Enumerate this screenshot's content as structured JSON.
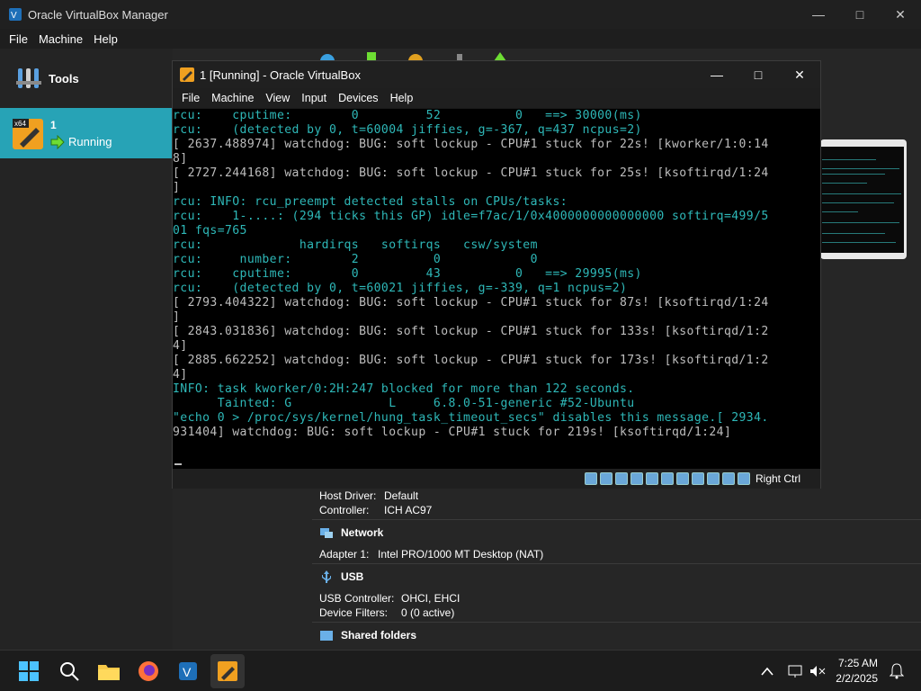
{
  "manager": {
    "title": "Oracle VirtualBox Manager",
    "menu": [
      "File",
      "Machine",
      "Help"
    ],
    "tools_label": "Tools",
    "vm": {
      "name": "1",
      "state": "Running",
      "badge": "x64"
    },
    "details": {
      "audio": {
        "host_driver_label": "Host Driver:",
        "host_driver": "Default",
        "controller_label": "Controller:",
        "controller": "ICH AC97"
      },
      "network": {
        "title": "Network",
        "adapter_label": "Adapter 1:",
        "adapter": "Intel PRO/1000 MT Desktop (NAT)"
      },
      "usb": {
        "title": "USB",
        "controller_label": "USB Controller:",
        "controller": "OHCI, EHCI",
        "filters_label": "Device Filters:",
        "filters": "0 (0 active)"
      },
      "shared": {
        "title": "Shared folders"
      }
    }
  },
  "vm_window": {
    "title": "1 [Running] - Oracle VirtualBox",
    "menu": [
      "File",
      "Machine",
      "View",
      "Input",
      "Devices",
      "Help"
    ],
    "host_key": "Right Ctrl",
    "console_lines": [
      {
        "text": "rcu:    cputime:        0         52          0   ==> 30000(ms)",
        "color": "teal"
      },
      {
        "text": "rcu:    (detected by 0, t=60004 jiffies, g=-367, q=437 ncpus=2)",
        "color": "teal"
      },
      {
        "text": "[ 2637.488974] watchdog: BUG: soft lockup - CPU#1 stuck for 22s! [kworker/1:0:14",
        "color": "grey"
      },
      {
        "text": "8]",
        "color": "grey"
      },
      {
        "text": "[ 2727.244168] watchdog: BUG: soft lockup - CPU#1 stuck for 25s! [ksoftirqd/1:24",
        "color": "grey"
      },
      {
        "text": "]",
        "color": "grey"
      },
      {
        "text": "rcu: INFO: rcu_preempt detected stalls on CPUs/tasks:",
        "color": "teal"
      },
      {
        "text": "rcu:    1-....: (294 ticks this GP) idle=f7ac/1/0x4000000000000000 softirq=499/5",
        "color": "teal"
      },
      {
        "text": "01 fqs=765",
        "color": "teal"
      },
      {
        "text": "rcu:             hardirqs   softirqs   csw/system",
        "color": "teal"
      },
      {
        "text": "rcu:     number:        2          0            0",
        "color": "teal"
      },
      {
        "text": "rcu:    cputime:        0         43          0   ==> 29995(ms)",
        "color": "teal"
      },
      {
        "text": "rcu:    (detected by 0, t=60021 jiffies, g=-339, q=1 ncpus=2)",
        "color": "teal"
      },
      {
        "text": "[ 2793.404322] watchdog: BUG: soft lockup - CPU#1 stuck for 87s! [ksoftirqd/1:24",
        "color": "grey"
      },
      {
        "text": "]",
        "color": "grey"
      },
      {
        "text": "[ 2843.031836] watchdog: BUG: soft lockup - CPU#1 stuck for 133s! [ksoftirqd/1:2",
        "color": "grey"
      },
      {
        "text": "4]",
        "color": "grey"
      },
      {
        "text": "[ 2885.662252] watchdog: BUG: soft lockup - CPU#1 stuck for 173s! [ksoftirqd/1:2",
        "color": "grey"
      },
      {
        "text": "4]",
        "color": "grey"
      },
      {
        "text": "INFO: task kworker/0:2H:247 blocked for more than 122 seconds.",
        "color": "teal"
      },
      {
        "text": "      Tainted: G             L     6.8.0-51-generic #52-Ubuntu",
        "color": "teal"
      },
      {
        "text": "\"echo 0 > /proc/sys/kernel/hung_task_timeout_secs\" disables this message.[ 2934.",
        "color": "teal"
      },
      {
        "text": "931404] watchdog: BUG: soft lockup - CPU#1 stuck for 219s! [ksoftirqd/1:24]",
        "color": "grey"
      }
    ]
  },
  "taskbar": {
    "time": "7:25 AM",
    "date": "2/2/2025"
  },
  "colors": {
    "teal_text": "#2eb8b8",
    "grey_text": "#bdbdbd",
    "selection": "#27a3b6"
  }
}
